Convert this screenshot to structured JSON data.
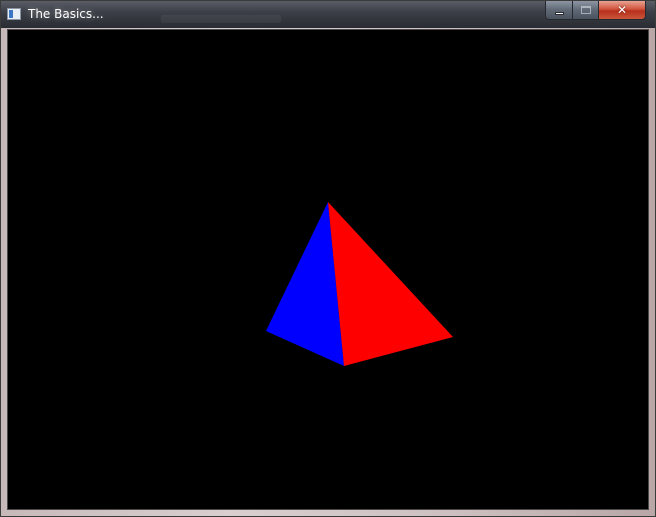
{
  "window": {
    "title": "The Basics...",
    "icon": "application-window-icon"
  },
  "caption_buttons": {
    "minimize_icon": "minimize-icon",
    "maximize_icon": "maximize-icon",
    "close_icon": "close-icon",
    "close_glyph": "✕"
  },
  "viewport": {
    "background_color": "#000000",
    "pyramid": {
      "left_face_color": "#0000ff",
      "right_face_color": "#ff0000"
    }
  }
}
